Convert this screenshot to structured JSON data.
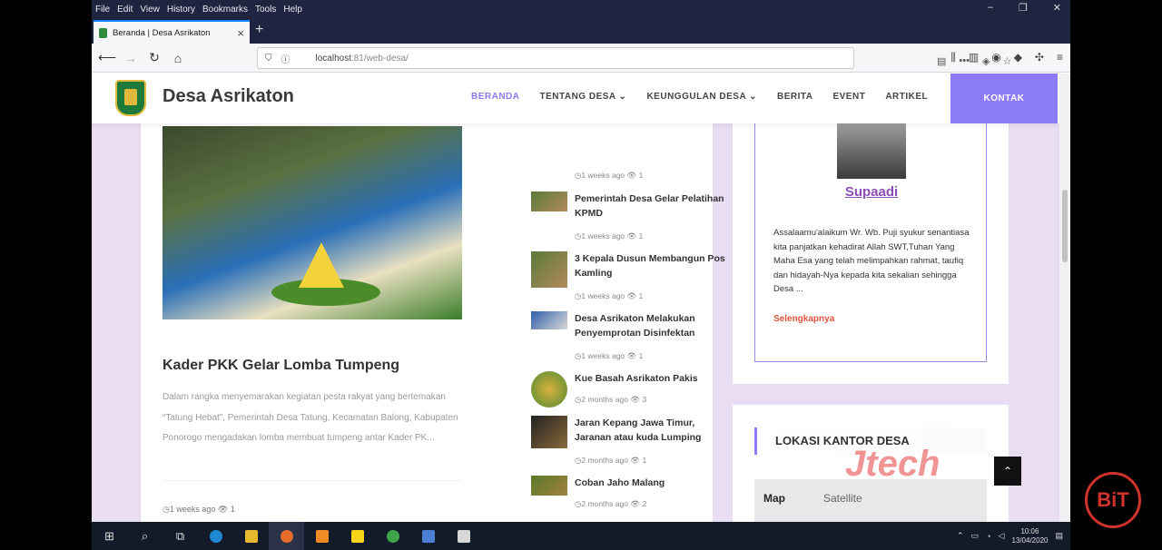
{
  "browser": {
    "menu": [
      "File",
      "Edit",
      "View",
      "History",
      "Bookmarks",
      "Tools",
      "Help"
    ],
    "tab_title": "Beranda | Desa Asrikaton",
    "url_host": "localhost",
    "url_port": ":81/web-desa/"
  },
  "site": {
    "title": "Desa Asrikaton",
    "nav": [
      "BERANDA",
      "TENTANG DESA",
      "KEUNGGULAN DESA",
      "BERITA",
      "EVENT",
      "ARTIKEL"
    ],
    "contact": "KONTAK"
  },
  "post": {
    "title": "Kader PKK Gelar Lomba Tumpeng",
    "excerpt": "Dalam rangka menyemarakan kegiatan pesta rakyat yang bertemakan “Tatung Hebat”, Pemerintah Desa Tatung, Kecamatan Balong, Kabupaten Ponorogo mengadakan lomba membuat tumpeng antar Kader PK...",
    "meta": "1 weeks ago   👁 1"
  },
  "recent_meta_top": "1 weeks ago   👁 1",
  "recent": [
    {
      "title": "Pemerintah Desa Gelar Pelatihan KPMD",
      "meta": "1 weeks ago   👁 1"
    },
    {
      "title": "3 Kepala Dusun Membangun Pos Kamling",
      "meta": "1 weeks ago   👁 1"
    },
    {
      "title": "Desa Asrikaton Melakukan Penyemprotan Disinfektan",
      "meta": "1 weeks ago   👁 1"
    },
    {
      "title": "Kue Basah Asrikaton Pakis",
      "meta": "2 months ago   👁 3"
    },
    {
      "title": "Jaran Kepang Jawa Timur, Jaranan atau kuda Lumping",
      "meta": "2 months ago   👁 1"
    },
    {
      "title": "Coban Jaho Malang",
      "meta": "2 months ago   👁 2"
    }
  ],
  "profile": {
    "name": "Supaadi",
    "greeting": "Assalaamu'alaikum Wr. Wb. Puji syukur senantiasa kita panjatkan kehadirat Allah SWT,Tuhan Yang Maha Esa yang telah melimpahkan rahmat, taufiq dan hidayah-Nya kepada kita sekalian sehingga Desa ...",
    "more": "Selengkapnya"
  },
  "location": {
    "title": "LOKASI KANTOR DESA",
    "map_tab": "Map",
    "satellite_tab": "Satellite"
  },
  "watermark": "Jtech",
  "taskbar": {
    "time": "10:06",
    "date": "13/04/2020"
  },
  "bit_logo": "BiT",
  "colors": {
    "accent": "#8c7cf7",
    "link_red": "#e3543d",
    "name_purple": "#8a4fb8"
  }
}
